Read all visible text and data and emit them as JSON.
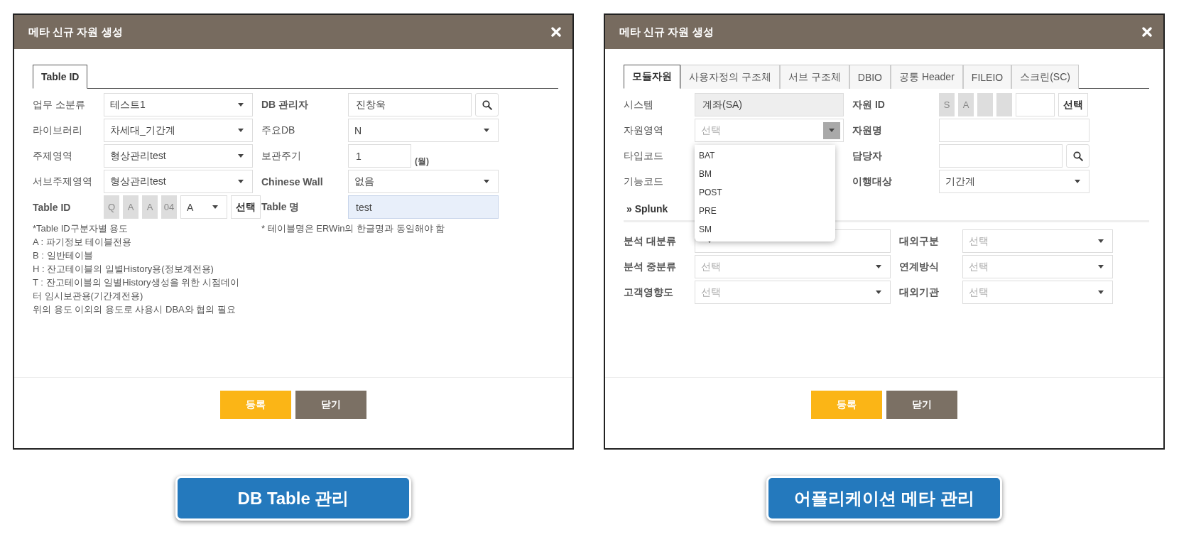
{
  "dialogs": [
    {
      "title": "메타 신규 자원 생성",
      "tabs": [
        {
          "label": "Table ID",
          "selected": true
        }
      ],
      "sections": [
        {
          "rows": [
            {
              "cells": [
                {
                  "label": "업무 소분류",
                  "strong": false,
                  "controls": [
                    {
                      "kind": "select",
                      "value": "테스트1",
                      "open": false
                    }
                  ]
                },
                {
                  "label": "DB 관리자",
                  "strong": true,
                  "controls": [
                    {
                      "kind": "input",
                      "value": "진창욱",
                      "readonly": false,
                      "focused": false
                    },
                    {
                      "kind": "search"
                    }
                  ]
                }
              ]
            },
            {
              "cells": [
                {
                  "label": "라이브러리",
                  "strong": false,
                  "controls": [
                    {
                      "kind": "select",
                      "value": "차세대_기간계",
                      "open": false
                    }
                  ]
                },
                {
                  "label": "주요DB",
                  "strong": false,
                  "controls": [
                    {
                      "kind": "select",
                      "value": "N",
                      "open": false
                    }
                  ]
                }
              ]
            },
            {
              "cells": [
                {
                  "label": "주제영역",
                  "strong": false,
                  "controls": [
                    {
                      "kind": "select",
                      "value": "형상관리test",
                      "open": false
                    }
                  ]
                },
                {
                  "label": "보관주기",
                  "strong": false,
                  "controls": [
                    {
                      "kind": "short-input",
                      "value": "1",
                      "readonly": false,
                      "focused": false
                    },
                    {
                      "kind": "unit",
                      "text": "(월)"
                    }
                  ]
                }
              ]
            },
            {
              "cells": [
                {
                  "label": "서브주제영역",
                  "strong": false,
                  "controls": [
                    {
                      "kind": "select",
                      "value": "형상관리test",
                      "open": false
                    }
                  ]
                },
                {
                  "label": "Chinese Wall",
                  "strong": true,
                  "controls": [
                    {
                      "kind": "select",
                      "value": "없음",
                      "open": false
                    }
                  ]
                }
              ]
            },
            {
              "cells": [
                {
                  "label": "Table ID",
                  "strong": true,
                  "controls": [
                    {
                      "kind": "code",
                      "text": "Q"
                    },
                    {
                      "kind": "code",
                      "text": "A"
                    },
                    {
                      "kind": "code",
                      "text": "A"
                    },
                    {
                      "kind": "code",
                      "text": "04"
                    },
                    {
                      "kind": "mini-select",
                      "value": "A",
                      "open": false
                    },
                    {
                      "kind": "button",
                      "label": "선택"
                    }
                  ]
                },
                {
                  "label": "Table 명",
                  "strong": true,
                  "controls": [
                    {
                      "kind": "input",
                      "value": "test",
                      "readonly": false,
                      "focused": true
                    }
                  ]
                }
              ]
            }
          ]
        }
      ],
      "notes": [
        [
          "*Table ID구분자별 용도",
          "A : 파기정보 테이블전용",
          "B : 일반테이블",
          "H : 잔고테이블의 일별History용(정보계전용)",
          "T : 잔고테이블의 일별History생성을 위한 시점데이",
          "터 임시보관용(기간계전용)",
          "위의 용도 이외의 용도로 사용시 DBA와 협의 필요"
        ],
        [
          "* 테이블명은 ERWin의 한글명과 동일해야 함"
        ]
      ],
      "buttons": [
        {
          "label": "등록",
          "kind": "primary"
        },
        {
          "label": "닫기",
          "kind": "secondary"
        }
      ],
      "caption": "DB Table 관리"
    },
    {
      "title": "메타 신규 자원 생성",
      "tabs": [
        {
          "label": "모듈자원",
          "selected": true
        },
        {
          "label": "사용자정의 구조체",
          "selected": false
        },
        {
          "label": "서브 구조체",
          "selected": false
        },
        {
          "label": "DBIO",
          "selected": false
        },
        {
          "label": "공통 Header",
          "selected": false
        },
        {
          "label": "FILEIO",
          "selected": false
        },
        {
          "label": "스크린(SC)",
          "selected": false
        }
      ],
      "sections": [
        {
          "rows": [
            {
              "cells": [
                {
                  "label": "시스템",
                  "strong": false,
                  "controls": [
                    {
                      "kind": "input",
                      "value": "계좌(SA)",
                      "readonly": true,
                      "focused": false
                    }
                  ]
                },
                {
                  "label": "자원 ID",
                  "strong": true,
                  "controls": [
                    {
                      "kind": "code",
                      "text": "S"
                    },
                    {
                      "kind": "code",
                      "text": "A"
                    },
                    {
                      "kind": "code"
                    },
                    {
                      "kind": "code"
                    },
                    {
                      "kind": "mini-input",
                      "readonly": false,
                      "focused": false
                    },
                    {
                      "kind": "button",
                      "label": "선택"
                    }
                  ]
                }
              ]
            },
            {
              "cells": [
                {
                  "label": "자원영역",
                  "strong": false,
                  "controls": [
                    {
                      "kind": "select",
                      "placeholder": "선택",
                      "open": true
                    }
                  ]
                },
                {
                  "label": "자원명",
                  "strong": true,
                  "controls": [
                    {
                      "kind": "input",
                      "readonly": false,
                      "focused": false
                    }
                  ]
                }
              ]
            },
            {
              "cells": [
                {
                  "label": "타입코드",
                  "strong": false
                },
                {
                  "label": "담당자",
                  "strong": true,
                  "controls": [
                    {
                      "kind": "input",
                      "readonly": false,
                      "focused": false
                    },
                    {
                      "kind": "search"
                    }
                  ]
                }
              ]
            },
            {
              "cells": [
                {
                  "label": "기능코드",
                  "strong": false
                },
                {
                  "label": "이행대상",
                  "strong": true,
                  "controls": [
                    {
                      "kind": "select",
                      "value": "기간계",
                      "open": false
                    }
                  ]
                }
              ]
            }
          ]
        },
        {
          "heading": "» Splunk",
          "rows": [
            {
              "cells": [
                {
                  "label": "분석 대분류",
                  "strong": true,
                  "controls": [
                    {
                      "kind": "select",
                      "open": false
                    }
                  ]
                },
                {
                  "label": "대외구분",
                  "strong": true,
                  "controls": [
                    {
                      "kind": "select",
                      "placeholder": "선택",
                      "open": false
                    }
                  ]
                }
              ]
            },
            {
              "cells": [
                {
                  "label": "분석 중분류",
                  "strong": true,
                  "controls": [
                    {
                      "kind": "select",
                      "placeholder": "선택",
                      "open": false
                    }
                  ]
                },
                {
                  "label": "연계방식",
                  "strong": true,
                  "controls": [
                    {
                      "kind": "select",
                      "placeholder": "선택",
                      "open": false
                    }
                  ]
                }
              ]
            },
            {
              "cells": [
                {
                  "label": "고객영향도",
                  "strong": true,
                  "controls": [
                    {
                      "kind": "select",
                      "placeholder": "선택",
                      "open": false
                    }
                  ]
                },
                {
                  "label": "대외기관",
                  "strong": true,
                  "controls": [
                    {
                      "kind": "select",
                      "placeholder": "선택",
                      "open": false
                    }
                  ]
                }
              ]
            }
          ]
        }
      ],
      "dropdown": {
        "options": [
          "BAT",
          "BM",
          "POST",
          "PRE",
          "SM"
        ]
      },
      "buttons": [
        {
          "label": "등록",
          "kind": "primary"
        },
        {
          "label": "닫기",
          "kind": "secondary"
        }
      ],
      "caption": "어플리케이션 메타 관리"
    }
  ]
}
